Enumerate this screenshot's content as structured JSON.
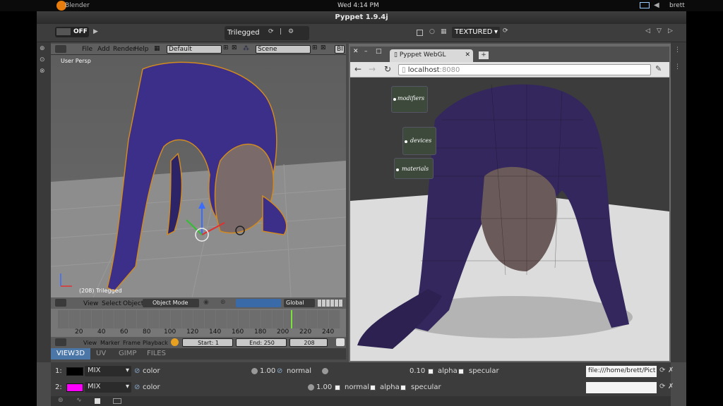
{
  "system_bar": {
    "app_label": "Blender",
    "clock": "Wed  4:14 PM",
    "user": "brett"
  },
  "window": {
    "title": "Pyppet 1.9.4j"
  },
  "toolbar": {
    "power_label": "OFF",
    "object_name": "Trilegged",
    "shading_mode": "TEXTURED"
  },
  "blender": {
    "menu": [
      "File",
      "Add",
      "Render",
      "Help"
    ],
    "layout": "Default",
    "scene": "Scene",
    "engine_abbrev": "Bl",
    "viewport_label": "User Persp",
    "selected_info": "(208) Trilegged",
    "vp_menu": [
      "View",
      "Select",
      "Object"
    ],
    "mode": "Object Mode",
    "orientation": "Global",
    "timeline_ticks": [
      "20",
      "40",
      "60",
      "80",
      "100",
      "120",
      "140",
      "160",
      "180",
      "200",
      "220",
      "240"
    ],
    "timeline_menu": [
      "View",
      "Marker",
      "Frame",
      "Playback"
    ],
    "start": "Start: 1",
    "end": "End: 250",
    "current_frame": "208",
    "tabs": [
      "VIEW3D",
      "UV",
      "GIMP",
      "FILES"
    ]
  },
  "browser": {
    "tab_title": "Pyppet WebGL",
    "url_host": "localhost",
    "url_port": ":8080",
    "nodes": [
      "modifiers",
      "devices",
      "materials"
    ]
  },
  "layers": [
    {
      "index": "1:",
      "color": "#000000",
      "blend": "MIX",
      "channel": "color",
      "value": "1.00",
      "mode": "normal",
      "value2": "0.10",
      "alpha": "alpha",
      "spec": "specular",
      "path": "file:///home/brett/Pict"
    },
    {
      "index": "2:",
      "color": "#ff00ff",
      "blend": "MIX",
      "channel": "color",
      "value": "1.00",
      "mode": "normal",
      "alpha": "alpha",
      "spec": "specular",
      "path": ""
    }
  ],
  "colors": {
    "accent": "#4a76a8",
    "playhead": "#7ee03c",
    "creature": "#3b2f8a"
  }
}
